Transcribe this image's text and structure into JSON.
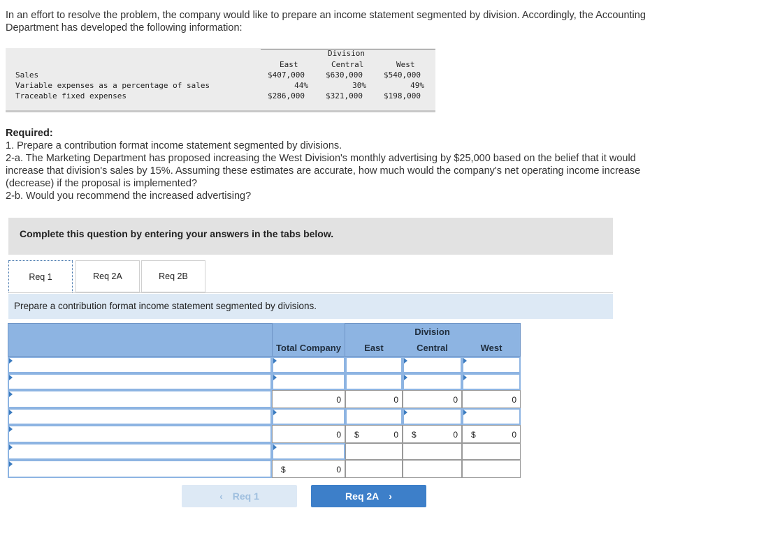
{
  "intro": "In an effort to resolve the problem, the company would like to prepare an income statement segmented by division. Accordingly, the Accounting Department has developed the following information:",
  "info": {
    "division_label": "Division",
    "columns": [
      "East",
      "Central",
      "West"
    ],
    "rows": [
      {
        "label": "Sales",
        "values": [
          "$407,000",
          "$630,000",
          "$540,000"
        ]
      },
      {
        "label": "Variable expenses as a percentage of sales",
        "values": [
          "44%",
          "30%",
          "49%"
        ]
      },
      {
        "label": "Traceable fixed expenses",
        "values": [
          "$286,000",
          "$321,000",
          "$198,000"
        ]
      }
    ]
  },
  "required": {
    "heading": "Required:",
    "lines": [
      "1. Prepare a contribution format income statement segmented by divisions.",
      "2-a. The Marketing Department has proposed increasing the West Division's monthly advertising by $25,000 based on the belief that it would increase that division's sales by 15%. Assuming these estimates are accurate, how much would the company's net operating income increase (decrease) if the proposal is implemented?",
      "2-b. Would you recommend the increased advertising?"
    ]
  },
  "banner": "Complete this question by entering your answers in the tabs below.",
  "tabs": [
    "Req 1",
    "Req 2A",
    "Req 2B"
  ],
  "instruction": "Prepare a contribution format income statement segmented by divisions.",
  "table": {
    "division_header": "Division",
    "col_headers": [
      "Total Company",
      "East",
      "Central",
      "West"
    ],
    "zero": "0",
    "dollar": "$"
  },
  "nav": {
    "prev": "Req 1",
    "next": "Req 2A"
  },
  "colors": {
    "header_blue": "#8db4e2",
    "button_blue": "#3d7fc9"
  }
}
